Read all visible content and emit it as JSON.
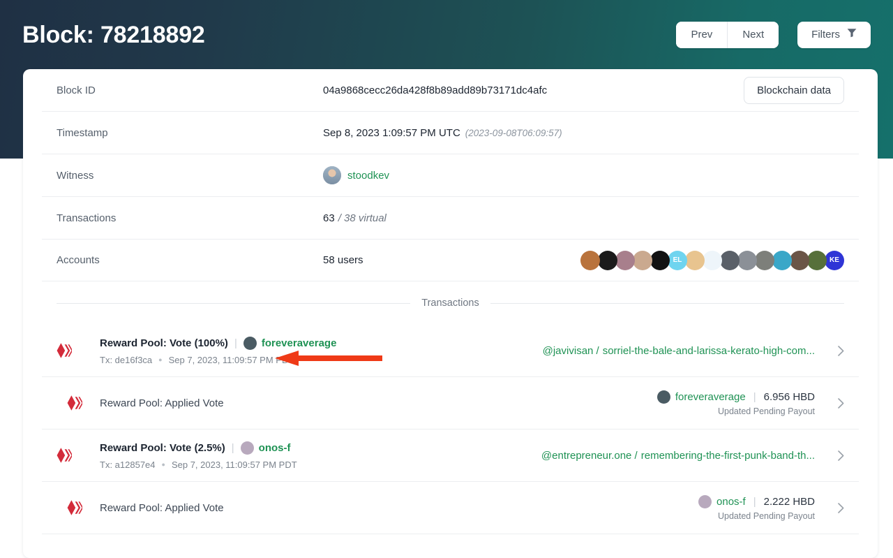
{
  "header": {
    "title": "Block: 78218892",
    "prev_label": "Prev",
    "next_label": "Next",
    "filters_label": "Filters",
    "filter_icon": "funnel-icon"
  },
  "colors": {
    "brand_green": "#1f9254",
    "hive_red": "#d32b3a",
    "band_left": "#1f3044",
    "band_right": "#15706b",
    "annotation_red": "#ef3a17"
  },
  "block": {
    "rows": [
      {
        "label": "Block ID",
        "value": "04a9868cecc26da428f8b89add89b73171dc4afc"
      },
      {
        "label": "Timestamp",
        "value": "Sep 8, 2023 1:09:57 PM UTC",
        "note": "(2023-09-08T06:09:57)"
      },
      {
        "label": "Witness",
        "value": "stoodkev"
      },
      {
        "label": "Transactions",
        "value": "63",
        "note": "/ 38 virtual"
      },
      {
        "label": "Accounts",
        "value": "58 users"
      }
    ],
    "blockchain_data_label": "Blockchain data"
  },
  "accounts_avatars": [
    {
      "name": "avatar-1",
      "bg": "#b9733c",
      "initials": ""
    },
    {
      "name": "avatar-2",
      "bg": "#1b1b1b",
      "initials": ""
    },
    {
      "name": "avatar-3",
      "bg": "#a87f8c",
      "initials": ""
    },
    {
      "name": "avatar-4",
      "bg": "#caa98f",
      "initials": ""
    },
    {
      "name": "avatar-5",
      "bg": "#121212",
      "initials": ""
    },
    {
      "name": "avatar-6",
      "bg": "#6fd4ef",
      "initials": "EL"
    },
    {
      "name": "avatar-7",
      "bg": "#e8c48f",
      "initials": ""
    },
    {
      "name": "avatar-8",
      "bg": "#eef5fa",
      "initials": ""
    },
    {
      "name": "avatar-9",
      "bg": "#5a6068",
      "initials": ""
    },
    {
      "name": "avatar-10",
      "bg": "#8b9097",
      "initials": ""
    },
    {
      "name": "avatar-11",
      "bg": "#7d7f7a",
      "initials": ""
    },
    {
      "name": "avatar-12",
      "bg": "#3aa7c8",
      "initials": ""
    },
    {
      "name": "avatar-13",
      "bg": "#6b5547",
      "initials": ""
    },
    {
      "name": "avatar-14",
      "bg": "#57703a",
      "initials": ""
    },
    {
      "name": "avatar-15",
      "bg": "#2f35d6",
      "initials": "KE"
    }
  ],
  "transactions_divider_label": "Transactions",
  "transactions": [
    {
      "kind": "vote",
      "title": "Reward Pool: Vote (100%)",
      "voter": "foreveraverage",
      "voter_avatar_bg": "#4a5b63",
      "tx_id": "Tx: de16f3ca",
      "time": "Sep 7, 2023, 11:09:57 PM PDT",
      "permlink_author": "@javivisan /",
      "permlink_slug": "sorriel-the-bale-and-larissa-kerato-high-com...",
      "chevron": "chevron-right-icon"
    },
    {
      "kind": "applied",
      "title": "Reward Pool: Applied Vote",
      "payout_user": "foreveraverage",
      "payout_avatar_bg": "#4a5b63",
      "payout_amount": "6.956 HBD",
      "payout_sub": "Updated Pending Payout",
      "chevron": "chevron-right-icon"
    },
    {
      "kind": "vote",
      "title": "Reward Pool: Vote (2.5%)",
      "voter": "onos-f",
      "voter_avatar_bg": "#b8a9bd",
      "tx_id": "Tx: a12857e4",
      "time": "Sep 7, 2023, 11:09:57 PM PDT",
      "permlink_author": "@entrepreneur.one /",
      "permlink_slug": "remembering-the-first-punk-band-th...",
      "chevron": "chevron-right-icon"
    },
    {
      "kind": "applied",
      "title": "Reward Pool: Applied Vote",
      "payout_user": "onos-f",
      "payout_avatar_bg": "#b8a9bd",
      "payout_amount": "2.222 HBD",
      "payout_sub": "Updated Pending Payout",
      "chevron": "chevron-right-icon"
    }
  ],
  "annotation": {
    "type": "arrow",
    "description": "red arrow pointing left at transaction timestamp"
  }
}
